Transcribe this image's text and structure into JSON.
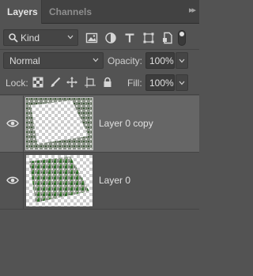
{
  "tabs": [
    {
      "label": "Layers",
      "active": true
    },
    {
      "label": "Channels",
      "active": false
    }
  ],
  "filter": {
    "kind_label": "Kind",
    "icons": [
      "image-filter-icon",
      "adjustment-filter-icon",
      "type-filter-icon",
      "shape-filter-icon",
      "smart-object-filter-icon"
    ],
    "toggle_on": true
  },
  "blend": {
    "mode": "Normal",
    "opacity_label": "Opacity:",
    "opacity_value": "100%"
  },
  "lock": {
    "label": "Lock:",
    "icons": [
      "lock-transparent-pixels-icon",
      "lock-image-pixels-icon",
      "lock-position-icon",
      "lock-artboard-icon",
      "lock-all-icon"
    ],
    "fill_label": "Fill:",
    "fill_value": "100%"
  },
  "layers": [
    {
      "name": "Layer 0 copy",
      "visible": true,
      "selected": true
    },
    {
      "name": "Layer 0",
      "visible": true,
      "selected": false
    }
  ],
  "colors": {
    "panel_bg": "#535353",
    "selected_row": "#666666",
    "tab_bar": "#424242"
  }
}
